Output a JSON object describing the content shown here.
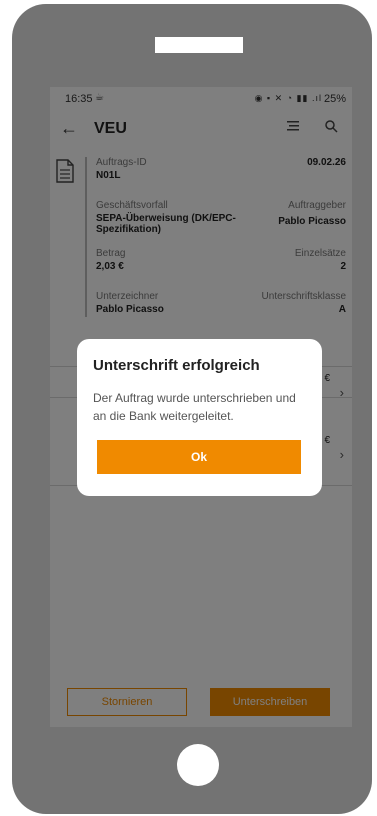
{
  "status_bar": {
    "time": "16:35",
    "icons_text": "◉ ▪ ✕ ◔ ▮▮ .ıl",
    "battery": "25%"
  },
  "app_bar": {
    "title": "VEU",
    "icons": [
      "arrow-left-icon",
      "filter-icon",
      "search-icon"
    ]
  },
  "order": {
    "id_label": "Auftrags-ID",
    "id_value": "N01L",
    "date": "09.02.26",
    "business_case_label": "Geschäftsvorfall",
    "business_case_value": "SEPA-Überweisung (DK/EPC-Spezifikation)",
    "originator_label": "Auftraggeber",
    "originator_value": "Pablo Picasso",
    "amount_label": "Betrag",
    "amount_value": "2,03 €",
    "single_items_label": "Einzelsätze",
    "single_items_value": "2",
    "signer_label": "Unterzeichner",
    "signer_value": "Pablo Picasso",
    "signature_class_label": "Unterschriftsklasse",
    "signature_class_value": "A"
  },
  "list": {
    "items": [
      {
        "amount_suffix": "€"
      },
      {
        "amount_suffix": "€"
      }
    ]
  },
  "buttons": {
    "cancel_label": "Stornieren",
    "sign_label": "Unterschreiben"
  },
  "dialog": {
    "title": "Unterschrift erfolgreich",
    "message": "Der Auftrag wurde unterschrieben und an die Bank weitergeleitet.",
    "ok_label": "Ok"
  },
  "colors": {
    "accent": "#f08a00",
    "frame": "#737373"
  }
}
